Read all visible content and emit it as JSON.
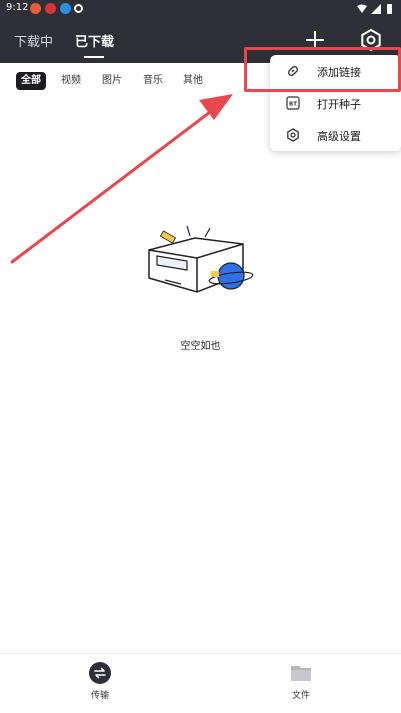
{
  "status_bar": {
    "time": "9:12"
  },
  "header": {
    "tabs": [
      {
        "label": "下载中",
        "active": false
      },
      {
        "label": "已下载",
        "active": true
      }
    ],
    "add_icon": "plus-icon",
    "settings_icon": "gear-icon"
  },
  "filters": {
    "items": [
      "全部",
      "视频",
      "图片",
      "音乐",
      "其他"
    ],
    "active_index": 0
  },
  "empty_state": {
    "message": "空空如也",
    "illustration": "empty-box-planet"
  },
  "popup_menu": {
    "items": [
      {
        "label": "添加链接",
        "icon": "link-icon"
      },
      {
        "label": "打开种子",
        "icon": "bt-torrent-icon",
        "badge": "BT"
      },
      {
        "label": "高级设置",
        "icon": "hexagon-settings-icon"
      }
    ]
  },
  "annotation": {
    "color": "#e8474d",
    "target": "添加链接"
  },
  "bottom_nav": {
    "items": [
      {
        "label": "传输",
        "icon": "transfer-icon",
        "active": true
      },
      {
        "label": "文件",
        "icon": "folder-icon",
        "active": false
      }
    ]
  },
  "colors": {
    "header_bg": "#2f3037",
    "accent_red": "#e8474d",
    "planet_blue": "#2f6fe8",
    "sticker_yellow": "#f5c84a"
  }
}
